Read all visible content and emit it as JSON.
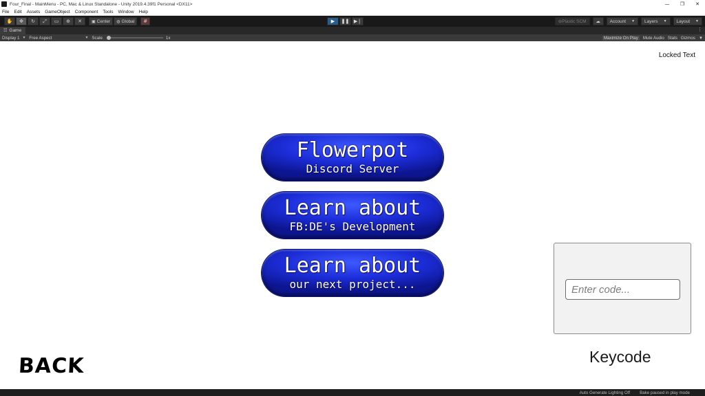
{
  "window": {
    "title": "Four_Final - MainMenu - PC, Mac & Linux Standalone - Unity 2019.4.39f1 Personal <DX11>",
    "controls": [
      "—",
      "❐",
      "✕"
    ]
  },
  "menubar": {
    "items": [
      "File",
      "Edit",
      "Assets",
      "GameObject",
      "Component",
      "Tools",
      "Window",
      "Help"
    ]
  },
  "toolbar": {
    "pivot_label": "Center",
    "space_label": "Global",
    "plastic_label": "Plastic SCM",
    "account_label": "Account",
    "layers_label": "Layers",
    "layout_label": "Layout"
  },
  "game_tab": {
    "label": "Game"
  },
  "game_controls": {
    "display": "Display 1",
    "aspect": "Free Aspect",
    "scale_label": "Scale",
    "scale_value": "1x",
    "maximize": "Maximize On Play",
    "mute": "Mute Audio",
    "stats": "Stats",
    "gizmos": "Gizmos"
  },
  "game": {
    "locked_text": "Locked Text",
    "buttons": [
      {
        "main": "Flowerpot",
        "sub": "Discord Server"
      },
      {
        "main": "Learn about",
        "sub": "FB:DE's Development"
      },
      {
        "main": "Learn about",
        "sub": "our next project..."
      }
    ],
    "code_placeholder": "Enter code...",
    "keycode_label": "Keycode",
    "back_label": "BACK"
  },
  "status": {
    "lighting": "Auto Generate Lighting Off",
    "bake": "Bake paused in play mode"
  }
}
